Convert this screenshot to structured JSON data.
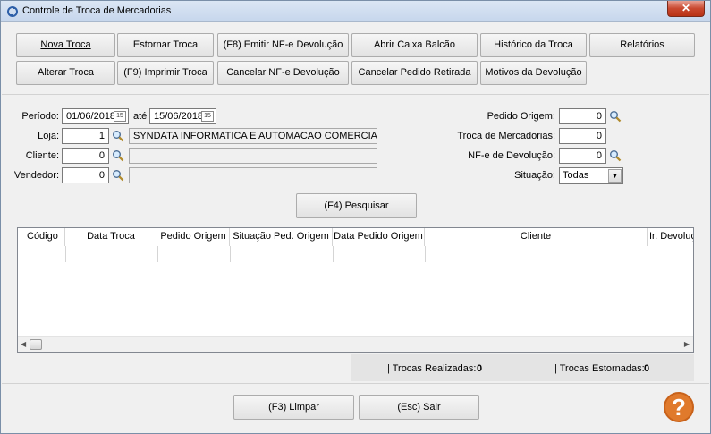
{
  "window": {
    "title": "Controle de Troca de Mercadorias",
    "close_label": "✕"
  },
  "toolbar": {
    "nova_troca": "Nova Troca",
    "estornar_troca": "Estornar Troca",
    "emitir_nfe": "(F8) Emitir NF-e Devolução",
    "abrir_caixa": "Abrir Caixa Balcão",
    "historico": "Histórico da Troca",
    "relatorios": "Relatórios",
    "alterar_troca": "Alterar Troca",
    "imprimir_troca": "(F9) Imprimir Troca",
    "cancelar_nfe": "Cancelar NF-e Devolução",
    "cancelar_pedido": "Cancelar Pedido Retirada",
    "motivos": "Motivos da Devolução"
  },
  "filters": {
    "periodo_label": "Período:",
    "periodo_inicio": "01/06/2018",
    "ate_label": "até",
    "periodo_fim": "15/06/2018",
    "loja_label": "Loja:",
    "loja_codigo": "1",
    "loja_nome": "SYNDATA INFORMATICA E AUTOMACAO COMERCIAL LTD",
    "cliente_label": "Cliente:",
    "cliente_codigo": "0",
    "cliente_nome": "",
    "vendedor_label": "Vendedor:",
    "vendedor_codigo": "0",
    "vendedor_nome": "",
    "pedido_origem_label": "Pedido Origem:",
    "pedido_origem": "0",
    "troca_label": "Troca de Mercadorias:",
    "troca": "0",
    "nfe_label": "NF-e de Devolução:",
    "nfe": "0",
    "situacao_label": "Situação:",
    "situacao": "Todas",
    "calendar_icon_text": "15"
  },
  "search_button": "(F4) Pesquisar",
  "grid": {
    "columns": [
      "Código",
      "Data Troca",
      "Pedido Origem",
      "Situação Ped. Origem",
      "Data Pedido Origem",
      "Cliente",
      "Ir. Devoluçã"
    ],
    "rows": []
  },
  "status": {
    "realizadas_label": "| Trocas Realizadas:",
    "realizadas": "0",
    "estornadas_label": "| Trocas Estornadas:",
    "estornadas": "0"
  },
  "footer": {
    "limpar": "(F3) Limpar",
    "sair": "(Esc) Sair",
    "help": "?"
  },
  "colors": {
    "titlebar": "#c6d6ec",
    "help": "#e07a2c",
    "close": "#c9482f"
  }
}
